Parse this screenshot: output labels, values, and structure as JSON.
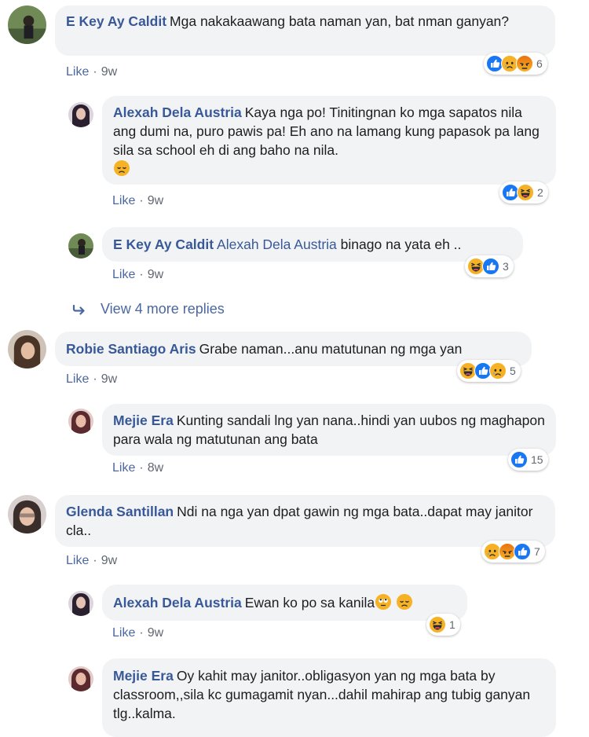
{
  "colors": {
    "link": "#385898",
    "bubble": "#f2f3f5",
    "like_blue": "#1877f2",
    "emoji_yellow": "#f7b125",
    "angry_orange": "#e9710f"
  },
  "comments": [
    {
      "author": "E Key Ay Caldit",
      "text": "Mga nakakaawang bata naman yan, bat nman ganyan?",
      "action": "Like",
      "time": "9w",
      "reactions": [
        "like-icon",
        "sad-icon",
        "angry-icon"
      ],
      "count": "6"
    },
    {
      "author": "Alexah Dela Austria",
      "text": "Kaya nga po! Tinitingnan ko mga sapatos nila ang dumi na, puro pawis pa! Eh ano na lamang kung papasok pa lang sila sa school eh di ang baho na nila.",
      "action": "Like",
      "time": "9w",
      "reactions": [
        "like-icon",
        "haha-icon"
      ],
      "count": "2"
    },
    {
      "author": "E Key Ay Caldit",
      "mention": "Alexah Dela Austria",
      "text": "binago na yata eh ..",
      "action": "Like",
      "time": "9w",
      "reactions": [
        "haha-icon",
        "like-icon"
      ],
      "count": "3"
    },
    {
      "author": "Robie Santiago Aris",
      "text": "Grabe naman...anu matutunan ng mga yan",
      "action": "Like",
      "time": "9w",
      "reactions": [
        "haha-icon",
        "like-icon",
        "sad-icon"
      ],
      "count": "5"
    },
    {
      "author": "Mejie Era",
      "text": "Kunting sandali lng yan nana..hindi yan uubos ng maghapon para wala ng matutunan ang bata",
      "action": "Like",
      "time": "8w",
      "reactions": [
        "like-icon"
      ],
      "count": "15"
    },
    {
      "author": "Glenda Santillan",
      "text": "Ndi na nga yan dpat gawin ng mga bata..dapat may janitor cla..",
      "action": "Like",
      "time": "9w",
      "reactions": [
        "sad-icon",
        "angry-icon",
        "like-icon"
      ],
      "count": "7"
    },
    {
      "author": "Alexah Dela Austria",
      "text": "Ewan ko po sa kanila",
      "action": "Like",
      "time": "9w",
      "reactions": [
        "haha-icon"
      ],
      "count": "1"
    },
    {
      "author": "Mejie Era",
      "text": "Oy kahit may janitor..obligasyon yan ng mga bata by classroom,,sila kc gumagamit nyan...dahil mahirap ang tubig ganyan tlg..kalma."
    }
  ],
  "view_more": "View 4 more replies"
}
